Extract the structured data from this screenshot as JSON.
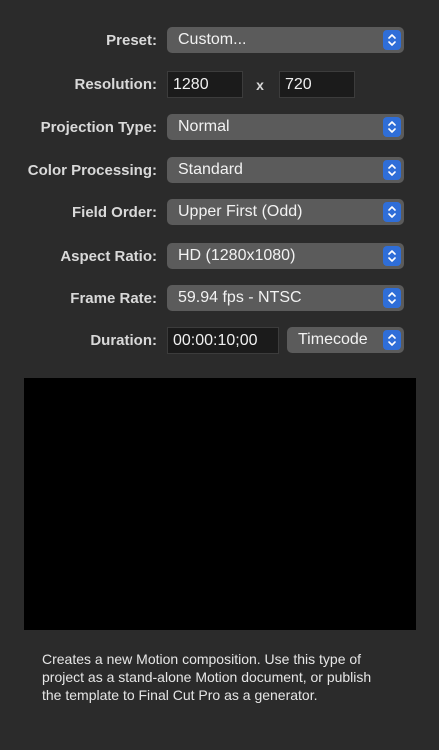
{
  "form": {
    "preset": {
      "label": "Preset:",
      "value": "Custom..."
    },
    "resolution": {
      "label": "Resolution:",
      "width": "1280",
      "separator": "x",
      "height": "720"
    },
    "projection_type": {
      "label": "Projection Type:",
      "value": "Normal"
    },
    "color_processing": {
      "label": "Color Processing:",
      "value": "Standard"
    },
    "field_order": {
      "label": "Field Order:",
      "value": "Upper First (Odd)"
    },
    "aspect_ratio": {
      "label": "Aspect Ratio:",
      "value": "HD (1280x1080)"
    },
    "frame_rate": {
      "label": "Frame Rate:",
      "value": "59.94 fps - NTSC"
    },
    "duration": {
      "label": "Duration:",
      "value": "00:00:10;00",
      "unit": "Timecode"
    }
  },
  "description": "Creates a new Motion composition. Use this type of project as a stand-alone Motion document, or publish the template to Final Cut Pro as a generator.",
  "colors": {
    "background": "#2b2b2b",
    "popup": "#5b5b5b",
    "accent": "#2f6ed8",
    "preview": "#000000"
  },
  "icons": {
    "popup_indicator": "chevron-up-down-icon"
  }
}
